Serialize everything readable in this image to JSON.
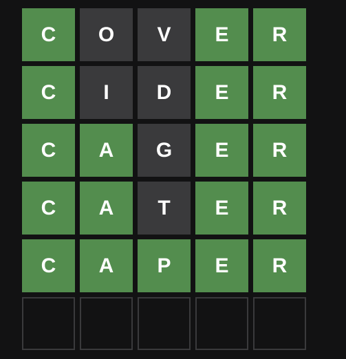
{
  "colors": {
    "background": "#121213",
    "correct": "#538d4e",
    "present": "#b59f3b",
    "absent": "#3a3a3c",
    "empty_border": "#3a3a3c",
    "text": "#ffffff"
  },
  "board": {
    "rows": [
      {
        "tiles": [
          {
            "letter": "C",
            "state": "correct"
          },
          {
            "letter": "O",
            "state": "absent"
          },
          {
            "letter": "V",
            "state": "absent"
          },
          {
            "letter": "E",
            "state": "correct"
          },
          {
            "letter": "R",
            "state": "correct"
          }
        ]
      },
      {
        "tiles": [
          {
            "letter": "C",
            "state": "correct"
          },
          {
            "letter": "I",
            "state": "absent"
          },
          {
            "letter": "D",
            "state": "absent"
          },
          {
            "letter": "E",
            "state": "correct"
          },
          {
            "letter": "R",
            "state": "correct"
          }
        ]
      },
      {
        "tiles": [
          {
            "letter": "C",
            "state": "correct"
          },
          {
            "letter": "A",
            "state": "correct"
          },
          {
            "letter": "G",
            "state": "absent"
          },
          {
            "letter": "E",
            "state": "correct"
          },
          {
            "letter": "R",
            "state": "correct"
          }
        ]
      },
      {
        "tiles": [
          {
            "letter": "C",
            "state": "correct"
          },
          {
            "letter": "A",
            "state": "correct"
          },
          {
            "letter": "T",
            "state": "absent"
          },
          {
            "letter": "E",
            "state": "correct"
          },
          {
            "letter": "R",
            "state": "correct"
          }
        ]
      },
      {
        "tiles": [
          {
            "letter": "C",
            "state": "correct"
          },
          {
            "letter": "A",
            "state": "correct"
          },
          {
            "letter": "P",
            "state": "correct"
          },
          {
            "letter": "E",
            "state": "correct"
          },
          {
            "letter": "R",
            "state": "correct"
          }
        ]
      },
      {
        "tiles": [
          {
            "letter": "",
            "state": "empty"
          },
          {
            "letter": "",
            "state": "empty"
          },
          {
            "letter": "",
            "state": "empty"
          },
          {
            "letter": "",
            "state": "empty"
          },
          {
            "letter": "",
            "state": "empty"
          }
        ]
      }
    ]
  }
}
